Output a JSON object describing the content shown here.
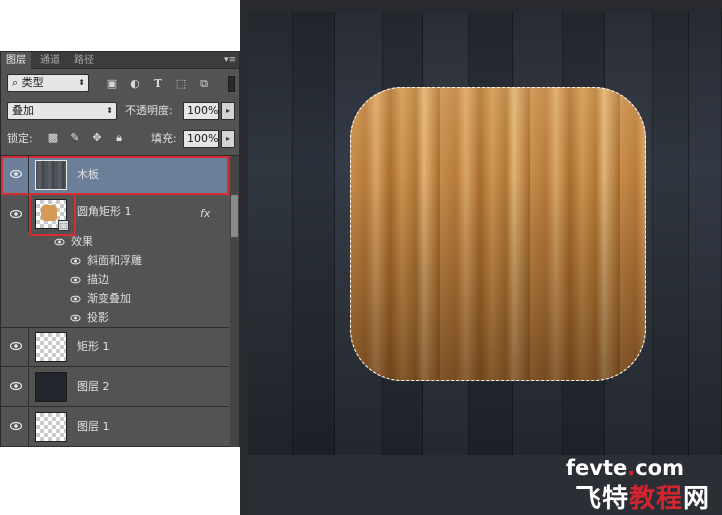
{
  "panel": {
    "tabs": [
      "图层",
      "通道",
      "路径"
    ],
    "filter": {
      "label": "类型"
    },
    "filter_icons": [
      "image-filter-icon",
      "adjustment-filter-icon",
      "type-filter-icon",
      "shape-filter-icon",
      "smart-object-filter-icon"
    ],
    "blend_mode": "叠加",
    "opacity_label": "不透明度:",
    "opacity_value": "100%",
    "lock_label": "锁定:",
    "fill_label": "填充:",
    "fill_value": "100%"
  },
  "layers": [
    {
      "name": "木板",
      "selected": true
    },
    {
      "name": "圆角矩形 1",
      "fx": "fx"
    },
    {
      "name": "矩形 1"
    },
    {
      "name": "图层 2"
    },
    {
      "name": "图层 1"
    }
  ],
  "effects": {
    "header": "效果",
    "items": [
      "斜面和浮雕",
      "描边",
      "渐变叠加",
      "投影"
    ]
  },
  "watermark": {
    "line1_prefix": "fevte",
    "line1_dot": ".",
    "line1_suffix": "com",
    "line2_a": "飞特",
    "line2_b": "教程",
    "line2_c": "网"
  },
  "colors": {
    "panel_bg": "#535353",
    "selection": "#6b7f99",
    "highlight_red": "#d62d35",
    "canvas_bg": "#282a30"
  }
}
